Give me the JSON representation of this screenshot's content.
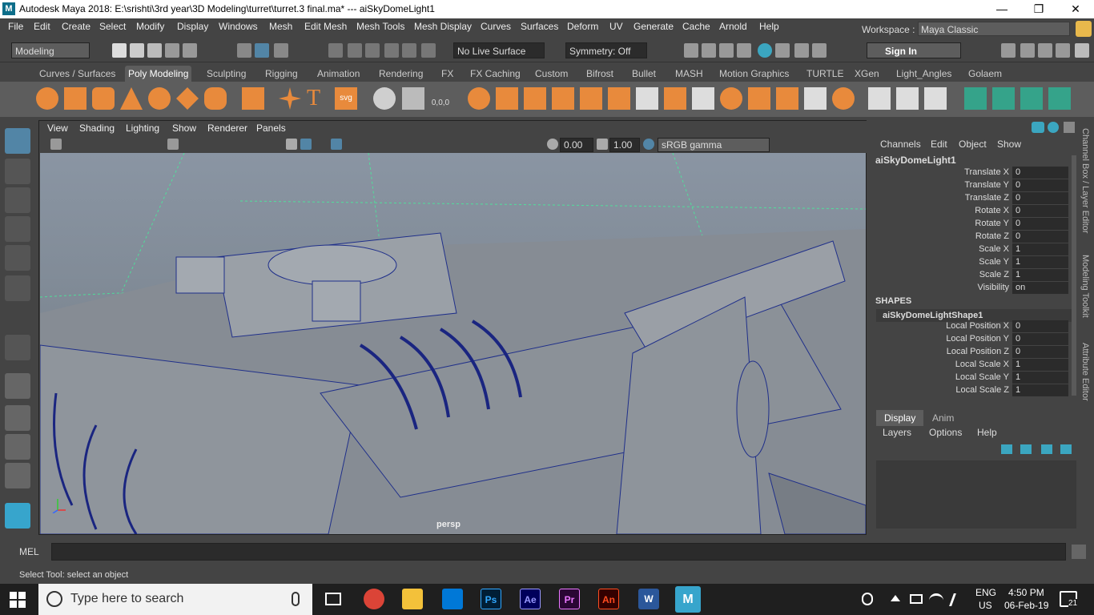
{
  "titlebar": {
    "logo": "M",
    "title": "Autodesk Maya 2018: E:\\srishti\\3rd year\\3D Modeling\\turret\\turret.3 final.ma*   ---   aiSkyDomeLight1",
    "minimize": "—",
    "restore": "❐",
    "close": "✕"
  },
  "menu": [
    "File",
    "Edit",
    "Create",
    "Select",
    "Modify",
    "Display",
    "Windows",
    "Mesh",
    "Edit Mesh",
    "Mesh Tools",
    "Mesh Display",
    "Curves",
    "Surfaces",
    "Deform",
    "UV",
    "Generate",
    "Cache",
    "Arnold",
    "Help"
  ],
  "workspace": {
    "label": "Workspace :",
    "value": "Maya Classic"
  },
  "status": {
    "mode": "Modeling",
    "live_surface": "No Live Surface",
    "symmetry": "Symmetry: Off",
    "sign_in": "Sign In"
  },
  "shelf_tabs": [
    "Curves / Surfaces",
    "Poly Modeling",
    "Sculpting",
    "Rigging",
    "Animation",
    "Rendering",
    "FX",
    "FX Caching",
    "Custom",
    "Bifrost",
    "Bullet",
    "MASH",
    "Motion Graphics",
    "TURTLE",
    "XGen",
    "Light_Angles",
    "Golaem"
  ],
  "shelf_active": "Poly Modeling",
  "shelf_text_items": {
    "text_tool": "T",
    "svg_tool": "svg",
    "coord_readout": "0,0,0"
  },
  "panel_menu": [
    "View",
    "Shading",
    "Lighting",
    "Show",
    "Renderer",
    "Panels"
  ],
  "panel_fields": {
    "exposure": "0.00",
    "gamma": "1.00",
    "color_space": "sRGB gamma"
  },
  "viewport": {
    "camera_label": "persp"
  },
  "channel_box": {
    "menu": [
      "Channels",
      "Edit",
      "Object",
      "Show"
    ],
    "object": "aiSkyDomeLight1",
    "attributes": [
      {
        "name": "Translate X",
        "value": "0"
      },
      {
        "name": "Translate Y",
        "value": "0"
      },
      {
        "name": "Translate Z",
        "value": "0"
      },
      {
        "name": "Rotate X",
        "value": "0"
      },
      {
        "name": "Rotate Y",
        "value": "0"
      },
      {
        "name": "Rotate Z",
        "value": "0"
      },
      {
        "name": "Scale X",
        "value": "1"
      },
      {
        "name": "Scale Y",
        "value": "1"
      },
      {
        "name": "Scale Z",
        "value": "1"
      },
      {
        "name": "Visibility",
        "value": "on"
      }
    ],
    "shapes_header": "SHAPES",
    "shape_name": "aiSkyDomeLightShape1",
    "shape_attributes": [
      {
        "name": "Local Position X",
        "value": "0"
      },
      {
        "name": "Local Position Y",
        "value": "0"
      },
      {
        "name": "Local Position Z",
        "value": "0"
      },
      {
        "name": "Local Scale X",
        "value": "1"
      },
      {
        "name": "Local Scale Y",
        "value": "1"
      },
      {
        "name": "Local Scale Z",
        "value": "1"
      }
    ]
  },
  "layer_editor": {
    "tabs": [
      "Display",
      "Anim"
    ],
    "active_tab": "Display",
    "menu": [
      "Layers",
      "Options",
      "Help"
    ]
  },
  "side_tabs": [
    "Channel Box / Layer Editor",
    "Modeling Toolkit",
    "Attribute Editor"
  ],
  "mel": {
    "label": "MEL"
  },
  "help_line": "Select Tool: select an object",
  "taskbar": {
    "search_placeholder": "Type here to search",
    "apps": [
      {
        "name": "chrome",
        "label": "",
        "color": "#db4437"
      },
      {
        "name": "explorer",
        "label": "",
        "color": "#f3c13a"
      },
      {
        "name": "store",
        "label": "",
        "color": "#0078d7"
      },
      {
        "name": "photoshop",
        "label": "Ps",
        "color": "#31a8ff"
      },
      {
        "name": "after-effects",
        "label": "Ae",
        "color": "#9999ff"
      },
      {
        "name": "premiere",
        "label": "Pr",
        "color": "#ea77ff"
      },
      {
        "name": "animate",
        "label": "An",
        "color": "#ff4c1f"
      },
      {
        "name": "word",
        "label": "W",
        "color": "#2b579a"
      },
      {
        "name": "maya",
        "label": "M",
        "color": "#37a5cc"
      }
    ],
    "lang": "ENG",
    "region": "US",
    "time": "4:50 PM",
    "date": "06-Feb-19",
    "notifications": "21"
  }
}
